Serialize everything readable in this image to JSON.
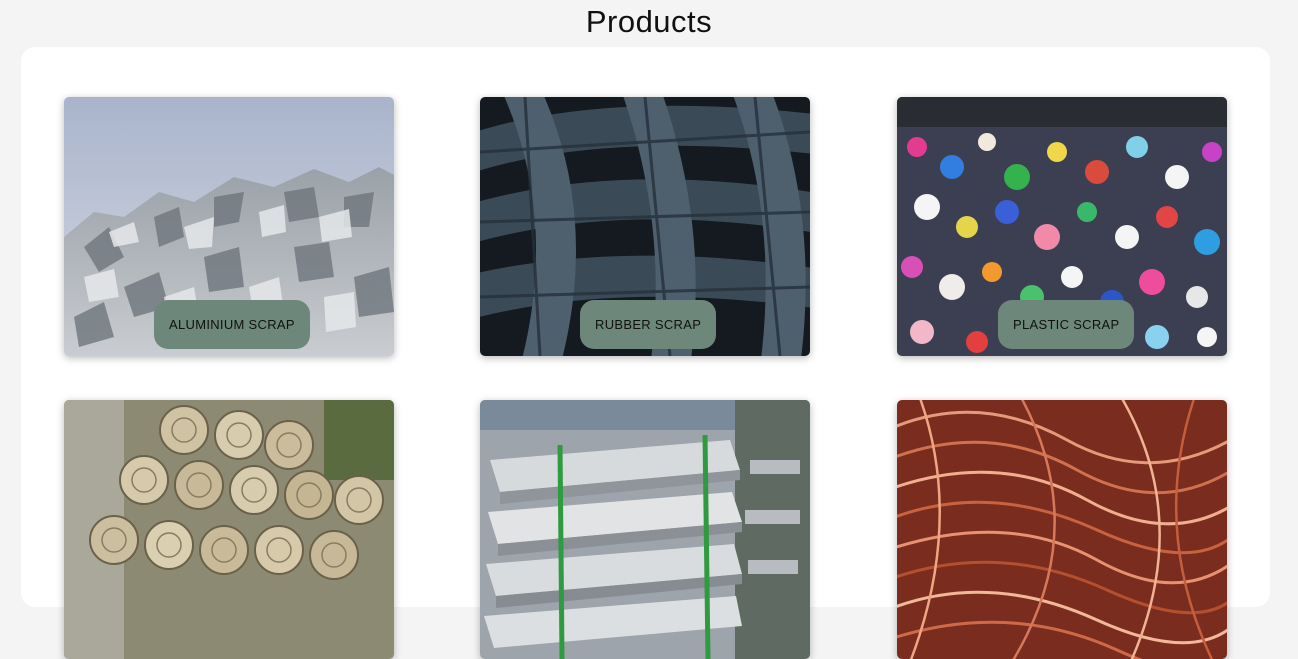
{
  "page": {
    "title": "Products"
  },
  "products": [
    {
      "label": "ALUMINIUM SCRAP",
      "image": "aluminium-scrap-image"
    },
    {
      "label": "RUBBER SCRAP",
      "image": "rubber-tyres-image"
    },
    {
      "label": "PLASTIC SCRAP",
      "image": "plastic-scrap-image"
    },
    {
      "label": "",
      "image": "rolled-metal-sheets-image"
    },
    {
      "label": "",
      "image": "aluminium-ingots-image"
    },
    {
      "label": "",
      "image": "copper-wire-image"
    }
  ],
  "colors": {
    "background": "#f4f4f4",
    "panel": "#ffffff",
    "tag": "#6d887b"
  }
}
